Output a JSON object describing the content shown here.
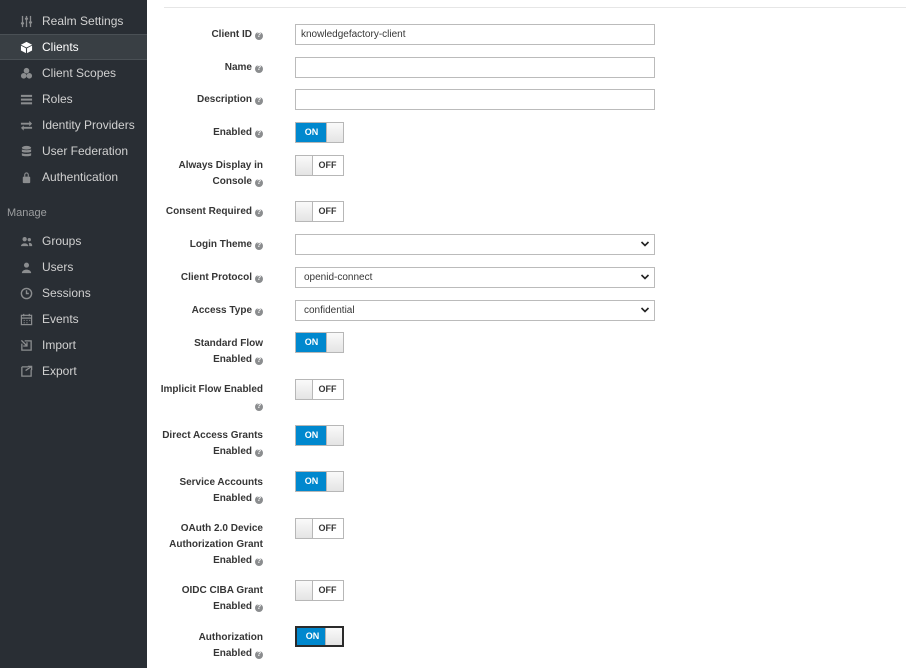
{
  "sidebar": {
    "items": [
      {
        "label": "Realm Settings",
        "icon": "sliders-icon"
      },
      {
        "label": "Clients",
        "icon": "cube-icon",
        "active": true
      },
      {
        "label": "Client Scopes",
        "icon": "cubes-icon"
      },
      {
        "label": "Roles",
        "icon": "list-icon"
      },
      {
        "label": "Identity Providers",
        "icon": "exchange-icon"
      },
      {
        "label": "User Federation",
        "icon": "database-icon"
      },
      {
        "label": "Authentication",
        "icon": "lock-icon"
      }
    ],
    "manage_label": "Manage",
    "manage_items": [
      {
        "label": "Groups",
        "icon": "users-icon"
      },
      {
        "label": "Users",
        "icon": "user-icon"
      },
      {
        "label": "Sessions",
        "icon": "clock-icon"
      },
      {
        "label": "Events",
        "icon": "calendar-icon"
      },
      {
        "label": "Import",
        "icon": "import-icon"
      },
      {
        "label": "Export",
        "icon": "export-icon"
      }
    ]
  },
  "form": {
    "client_id": {
      "label": "Client ID",
      "value": "knowledgefactory-client"
    },
    "name": {
      "label": "Name",
      "value": ""
    },
    "description": {
      "label": "Description",
      "value": ""
    },
    "enabled": {
      "label": "Enabled",
      "state": "ON"
    },
    "always_display": {
      "label_line1": "Always Display in",
      "label_line2": "Console",
      "state": "OFF"
    },
    "consent_required": {
      "label": "Consent Required",
      "state": "OFF"
    },
    "login_theme": {
      "label": "Login Theme",
      "value": ""
    },
    "client_protocol": {
      "label": "Client Protocol",
      "value": "openid-connect"
    },
    "access_type": {
      "label": "Access Type",
      "value": "confidential"
    },
    "standard_flow": {
      "label_line1": "Standard Flow",
      "label_line2": "Enabled",
      "state": "ON"
    },
    "implicit_flow": {
      "label_line1": "Implicit Flow Enabled",
      "state": "OFF"
    },
    "direct_access": {
      "label_line1": "Direct Access Grants",
      "label_line2": "Enabled",
      "state": "ON"
    },
    "service_accounts": {
      "label_line1": "Service Accounts",
      "label_line2": "Enabled",
      "state": "ON"
    },
    "oauth_device": {
      "label_line1": "OAuth 2.0 Device",
      "label_line2": "Authorization Grant",
      "label_line3": "Enabled",
      "state": "OFF"
    },
    "oidc_ciba": {
      "label_line1": "OIDC CIBA Grant",
      "label_line2": "Enabled",
      "state": "OFF"
    },
    "authorization": {
      "label_line1": "Authorization",
      "label_line2": "Enabled",
      "state": "ON"
    }
  },
  "help_glyph": "?",
  "colors": {
    "sidebar_bg": "#292e34",
    "active_bg": "#393f44",
    "toggle_on": "#0088ce"
  }
}
